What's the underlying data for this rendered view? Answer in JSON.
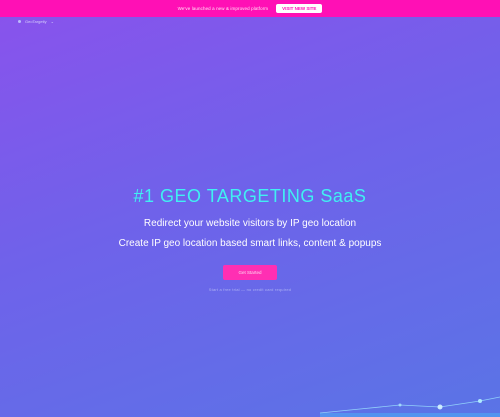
{
  "top_banner": {
    "text": "We've launched a new & improved platform",
    "button_label": "VISIT NEW SITE"
  },
  "nav": {
    "logo_text": "GeoTargetly"
  },
  "hero": {
    "title": "#1 GEO TARGETING SaaS",
    "subtitle_line1": "Redirect your website visitors by IP geo location",
    "subtitle_line2": "Create IP geo location based smart links, content & popups",
    "cta_label": "Get Started",
    "hint_text": "Start a free trial — no credit card required"
  },
  "colors": {
    "banner": "#ff10b5",
    "title": "#40f0f2",
    "cta": "#ff2fb3"
  }
}
